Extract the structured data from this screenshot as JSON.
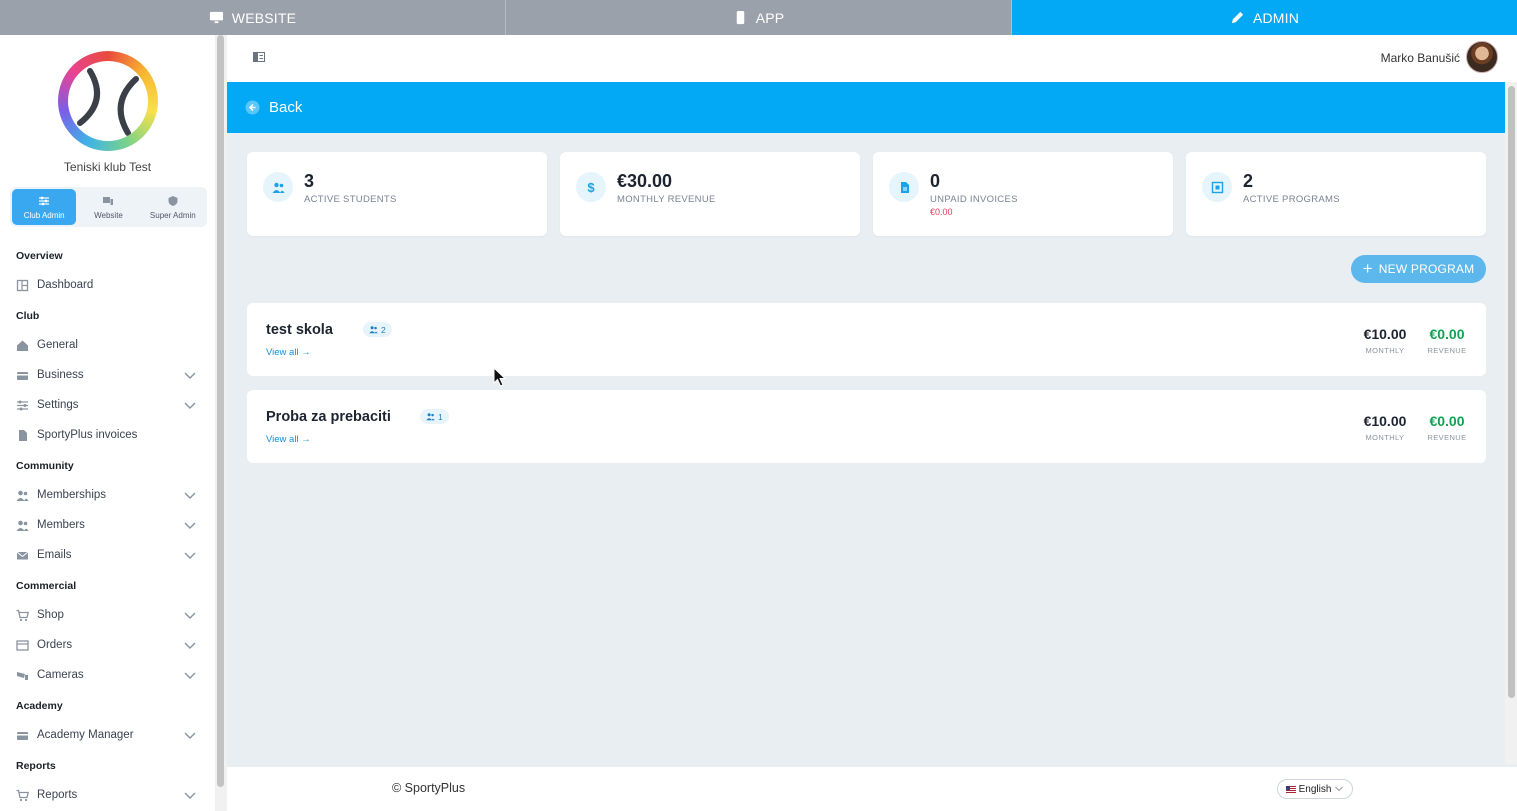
{
  "topbar": {
    "tabs": [
      {
        "label": "WEBSITE",
        "icon": "monitor-icon"
      },
      {
        "label": "APP",
        "icon": "phone-icon"
      },
      {
        "label": "ADMIN",
        "icon": "pencil-icon",
        "active": true
      }
    ]
  },
  "sidebar": {
    "club_name": "Teniski klub Test",
    "roles": [
      {
        "label": "Club Admin",
        "active": true
      },
      {
        "label": "Website"
      },
      {
        "label": "Super Admin"
      }
    ],
    "sections": [
      {
        "title": "Overview",
        "items": [
          {
            "label": "Dashboard"
          }
        ]
      },
      {
        "title": "Club",
        "items": [
          {
            "label": "General"
          },
          {
            "label": "Business"
          },
          {
            "label": "Settings"
          },
          {
            "label": "SportyPlus invoices"
          }
        ]
      },
      {
        "title": "Community",
        "items": [
          {
            "label": "Memberships"
          },
          {
            "label": "Members"
          },
          {
            "label": "Emails"
          }
        ]
      },
      {
        "title": "Commercial",
        "items": [
          {
            "label": "Shop"
          },
          {
            "label": "Orders"
          },
          {
            "label": "Cameras"
          }
        ]
      },
      {
        "title": "Academy",
        "items": [
          {
            "label": "Academy Manager"
          }
        ]
      },
      {
        "title": "Reports",
        "items": [
          {
            "label": "Reports"
          }
        ]
      }
    ]
  },
  "header": {
    "user_name": "Marko Banušić"
  },
  "backbar": {
    "label": "Back"
  },
  "stats": [
    {
      "value": "3",
      "label": "ACTIVE STUDENTS",
      "icon": "students-icon"
    },
    {
      "value": "€30.00",
      "label": "MONTHLY REVENUE",
      "icon": "dollar-icon",
      "glyph": "$"
    },
    {
      "value": "0",
      "label": "UNPAID INVOICES",
      "sub": "€0.00",
      "icon": "invoice-icon"
    },
    {
      "value": "2",
      "label": "ACTIVE PROGRAMS",
      "icon": "grid-icon"
    }
  ],
  "new_program": {
    "plus": "+",
    "label": "NEW PROGRAM"
  },
  "programs": [
    {
      "name": "test skola",
      "count": "2",
      "view_all": "View all →",
      "monthly": "€10.00",
      "monthly_label": "MONTHLY",
      "revenue": "€0.00",
      "revenue_label": "REVENUE"
    },
    {
      "name": "Proba za prebaciti",
      "count": "1",
      "view_all": "View all →",
      "monthly": "€10.00",
      "monthly_label": "MONTHLY",
      "revenue": "€0.00",
      "revenue_label": "REVENUE"
    }
  ],
  "footer": {
    "copyright": "© SportyPlus",
    "language": "English"
  },
  "colors": {
    "primary": "#03a9f4",
    "revenue_green": "#12a150",
    "unpaid_red": "#e23b5a"
  }
}
